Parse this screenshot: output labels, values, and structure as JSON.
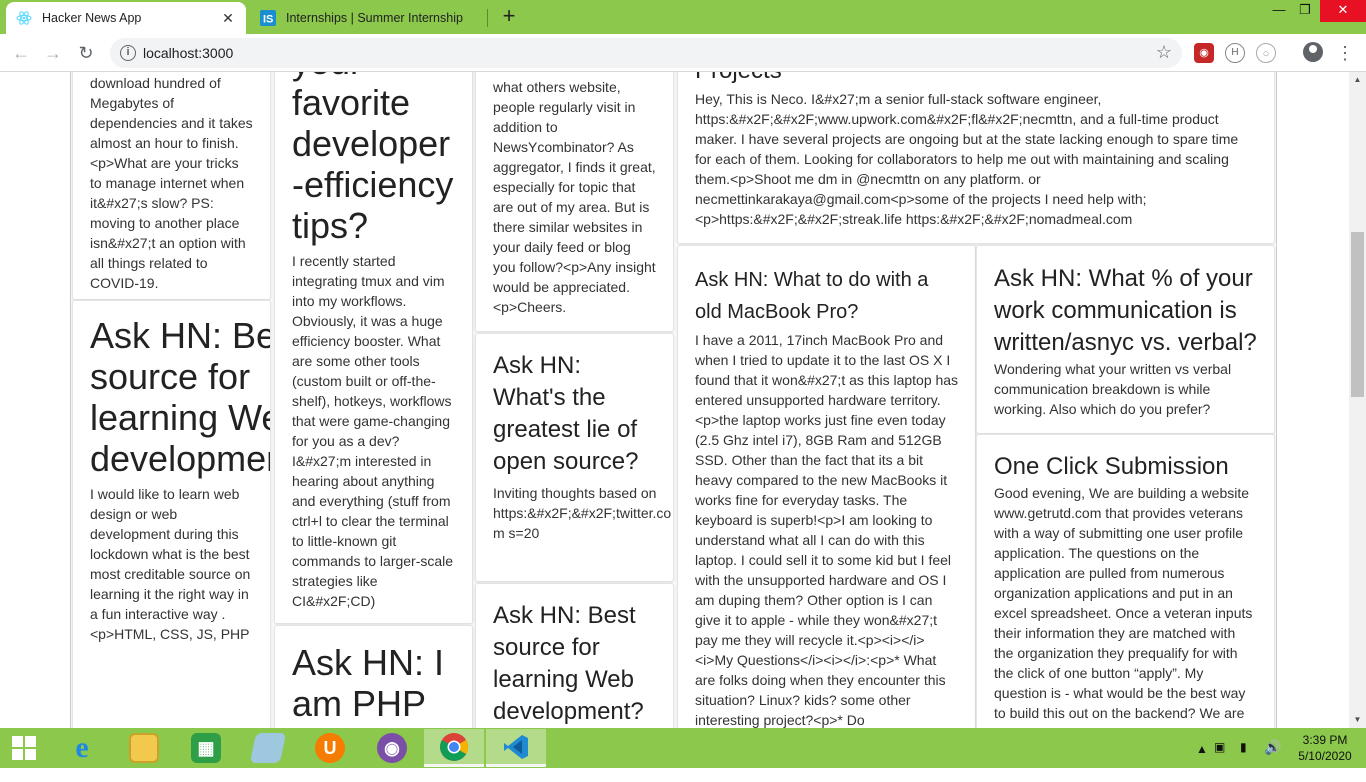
{
  "browser": {
    "tabs": [
      {
        "title": "Hacker News App",
        "icon": "react-icon"
      },
      {
        "title": "Internships | Summer Internship",
        "icon": "internshala-icon"
      }
    ],
    "tab_close_symbol": "✕",
    "new_tab_symbol": "+",
    "window_controls": {
      "minimize": "—",
      "maximize": "❐",
      "close": "✕"
    },
    "address": "localhost:3000",
    "colors": {
      "frame": "#8cc84b",
      "close_red": "#e81123"
    }
  },
  "feed": {
    "col1": [
      {
        "title": "",
        "body": "download hundred of Megabytes of dependencies and it takes almost an hour to finish.<p>What are your tricks to manage internet when it&#x27;s slow? PS: moving to another place isn&#x27;t an option with all things related to COVID-19."
      },
      {
        "title": "Ask HN: Best source for learning Web development",
        "body": "I would like to learn web design or web development during this lockdown what is the best most creditable source on learning it the right way in a fun interactive way .<p>HTML, CSS, JS, PHP"
      }
    ],
    "col2": [
      {
        "title": "your favorite developer-efficiency tips?",
        "body": "I recently started integrating tmux and vim into my workflows. Obviously, it was a huge efficiency booster. What are some other tools (custom built or off-the-shelf), hotkeys, workflows that were game-changing for you as a dev? I&#x27;m interested in hearing about anything and everything (stuff from ctrl+l to clear the terminal to little-known git commands to larger-scale strategies like CI&#x2F;CD)"
      },
      {
        "title": "Ask HN: I am PHP",
        "body": ""
      }
    ],
    "col3": [
      {
        "title": "",
        "body": "what others website, people regularly visit in addition to NewsYcombinator? As aggregator, I finds it great, especially for topic that are out of my area. But is there similar websites in your daily feed or blog you follow?<p>Any insight would be appreciated.<p>Cheers."
      },
      {
        "title": "Ask HN: What's the greatest lie of open source?",
        "body": "Inviting thoughts based on https:&#x2F;&#x2F;twitter.com s=20"
      },
      {
        "title": "Ask HN: Best source for learning Web development?",
        "body": ""
      }
    ],
    "wide": {
      "title": "Projects",
      "body": "Hey, This is Neco. I&#x27;m a senior full-stack software engineer, https:&#x2F;&#x2F;www.upwork.com&#x2F;fl&#x2F;necmttn, and a full-time product maker. I have several projects are ongoing but at the state lacking enough to spare time for each of them. Looking for collaborators to help me out with maintaining and scaling them.<p>Shoot me dm in @necmttn on any platform. or necmettinkarakaya@gmail.com<p>some of the projects I need help with;<p>https:&#x2F;&#x2F;streak.life https:&#x2F;&#x2F;nomadmeal.com"
    },
    "col4": [
      {
        "title": "Ask HN: What to do with a old MacBook Pro?",
        "body": "I have a 2011, 17inch MacBook Pro and when I tried to update it to the last OS X I found that it won&#x27;t as this laptop has entered unsupported hardware territory.<p>the laptop works just fine even today (2.5 Ghz intel i7), 8GB Ram and 512GB SSD. Other than the fact that its a bit heavy compared to the new MacBooks it works fine for everyday tasks. The keyboard is superb!<p>I am looking to understand what all I can do with this laptop. I could sell it to some kid but I feel with the unsupported hardware and OS I am duping them? Other option is I can give it to apple - while they won&#x27;t pay me they will recycle it.<p><i></i><i>My Questions</i><i></i>:<p>* What are folks doing when they encounter this situation? Linux? kids? some other interesting project?<p>* Do"
      }
    ],
    "col5": [
      {
        "title": "Ask HN: What % of your work communication is written/asnyc vs. verbal?",
        "body": "Wondering what your written vs verbal communication breakdown is while working. Also which do you prefer?"
      },
      {
        "title": "One Click Submission",
        "body": "Good evening, We are building a website www.getrutd.com that provides veterans with a way of submitting one user profile application. The questions on the application are pulled from numerous organization applications and put in an excel spreadsheet. Once a veteran inputs their information they are matched with the organization they prequalify for with the click of one button “apply”. My question is - what would be the best way to build this out on the backend? We are"
      }
    ]
  },
  "taskbar": {
    "apps": [
      "start-icon",
      "ie-icon",
      "file-explorer-icon",
      "store-icon",
      "notepad-icon",
      "uc-browser-icon",
      "github-desktop-icon",
      "chrome-icon",
      "vscode-icon"
    ],
    "time": "3:39 PM",
    "date": "5/10/2020"
  }
}
